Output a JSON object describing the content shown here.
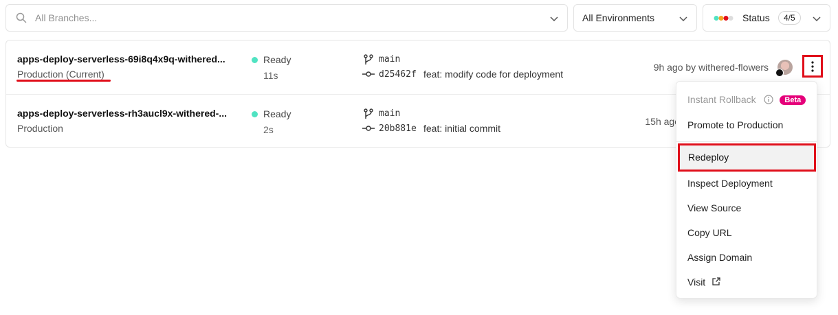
{
  "filters": {
    "search_placeholder": "All Branches...",
    "environment": "All Environments",
    "status_label": "Status",
    "status_count": "4/5"
  },
  "deployments": [
    {
      "name": "apps-deploy-serverless-69i8q4x9q-withered...",
      "environment": "Production (Current)",
      "status": "Ready",
      "duration": "11s",
      "branch": "main",
      "commit_sha": "d25462f",
      "commit_message": "feat: modify code for deployment",
      "time": "9h ago by withered-flowers"
    },
    {
      "name": "apps-deploy-serverless-rh3aucl9x-withered-...",
      "environment": "Production",
      "status": "Ready",
      "duration": "2s",
      "branch": "main",
      "commit_sha": "20b881e",
      "commit_message": "feat: initial commit",
      "time": "15h ago"
    }
  ],
  "menu": {
    "instant_rollback": "Instant Rollback",
    "beta": "Beta",
    "promote": "Promote to Production",
    "redeploy": "Redeploy",
    "inspect": "Inspect Deployment",
    "view_source": "View Source",
    "copy_url": "Copy URL",
    "assign_domain": "Assign Domain",
    "visit": "Visit"
  },
  "colors": {
    "ready": "#50e3c2",
    "highlight": "#e00e1a",
    "beta": "#e5007a"
  },
  "icons": [
    "search-icon",
    "chevron-down-icon",
    "status-dots-icon",
    "git-branch-icon",
    "git-commit-icon",
    "avatar",
    "github-icon",
    "more-vertical-icon",
    "info-icon",
    "external-link-icon"
  ]
}
